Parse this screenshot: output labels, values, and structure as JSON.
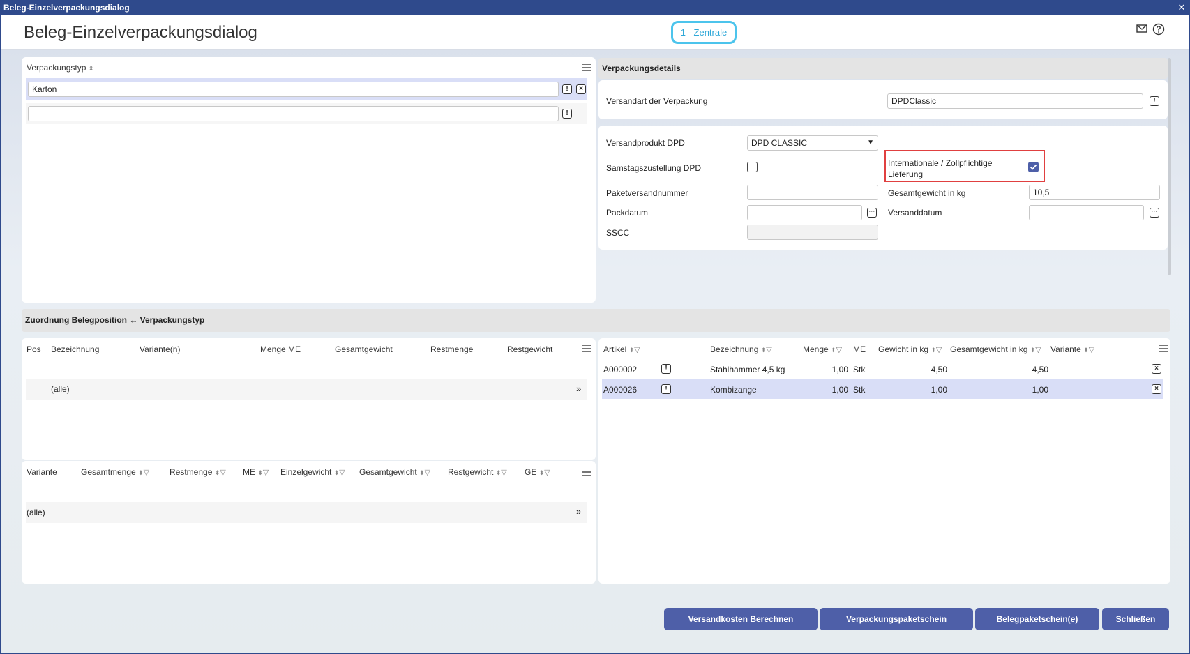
{
  "window": {
    "title": "Beleg-Einzelverpackungsdialog",
    "close_glyph": "✕"
  },
  "header": {
    "title": "Beleg-Einzelverpackungsdialog",
    "location_badge": "1 - Zentrale",
    "mail_icon": "mail-icon",
    "help_icon": "help-icon"
  },
  "packaging_types": {
    "column_header": "Verpackungstyp",
    "rows": [
      {
        "value": "Karton"
      },
      {
        "value": ""
      }
    ]
  },
  "details": {
    "section_title": "Verpackungsdetails",
    "shipping_method_label": "Versandart der Verpackung",
    "shipping_method_value": "DPDClassic",
    "dpd_product_label": "Versandprodukt DPD",
    "dpd_product_value": "DPD CLASSIC",
    "saturday_label": "Samstagszustellung DPD",
    "saturday_checked": false,
    "international_label_line1": "Internationale / Zollpflichtige",
    "international_label_line2": "Lieferung",
    "international_checked": true,
    "parcel_number_label": "Paketversandnummer",
    "parcel_number_value": "",
    "total_weight_label": "Gesamtgewicht in kg",
    "total_weight_value": "10,5",
    "pack_date_label": "Packdatum",
    "pack_date_value": "",
    "ship_date_label": "Versanddatum",
    "ship_date_value": "",
    "sscc_label": "SSCC",
    "sscc_value": ""
  },
  "assignment": {
    "section_title": "Zuordnung Belegposition ↔ Verpackungstyp",
    "positions": {
      "headers": [
        "Pos",
        "Bezeichnung",
        "Variante(n)",
        "Menge ME",
        "Gesamtgewicht",
        "Restmenge",
        "Restgewicht"
      ],
      "all_row": "(alle)",
      "expand_glyph": "»"
    },
    "variants": {
      "headers": [
        "Variante",
        "Gesamtmenge",
        "Restmenge",
        "ME",
        "Einzelgewicht",
        "Gesamtgewicht",
        "Restgewicht",
        "GE"
      ],
      "all_row": "(alle)",
      "expand_glyph": "»"
    },
    "articles": {
      "headers": [
        "Artikel",
        "Bezeichnung",
        "Menge",
        "ME",
        "Gewicht in kg",
        "Gesamtgewicht in kg",
        "Variante"
      ],
      "rows": [
        {
          "artikel": "A000002",
          "bezeichnung": "Stahlhammer 4,5 kg",
          "menge": "1,00",
          "me": "Stk",
          "gewicht": "4,50",
          "gesamtgewicht": "4,50",
          "variante": ""
        },
        {
          "artikel": "A000026",
          "bezeichnung": "Kombizange",
          "menge": "1,00",
          "me": "Stk",
          "gewicht": "1,00",
          "gesamtgewicht": "1,00",
          "variante": ""
        }
      ]
    }
  },
  "footer": {
    "calc_shipping": "Versandkosten Berechnen",
    "pack_slip_pre": "",
    "pack_slip": "Verpackungspaketschein",
    "doc_slip": "Belegpaketschein(e)",
    "close": "Schließen"
  },
  "colors": {
    "title_bar": "#2f4a8c",
    "button": "#4e5fa8",
    "badge": "#4cc4ec",
    "selected_row": "#d9def7",
    "highlight_border": "#e04040"
  }
}
